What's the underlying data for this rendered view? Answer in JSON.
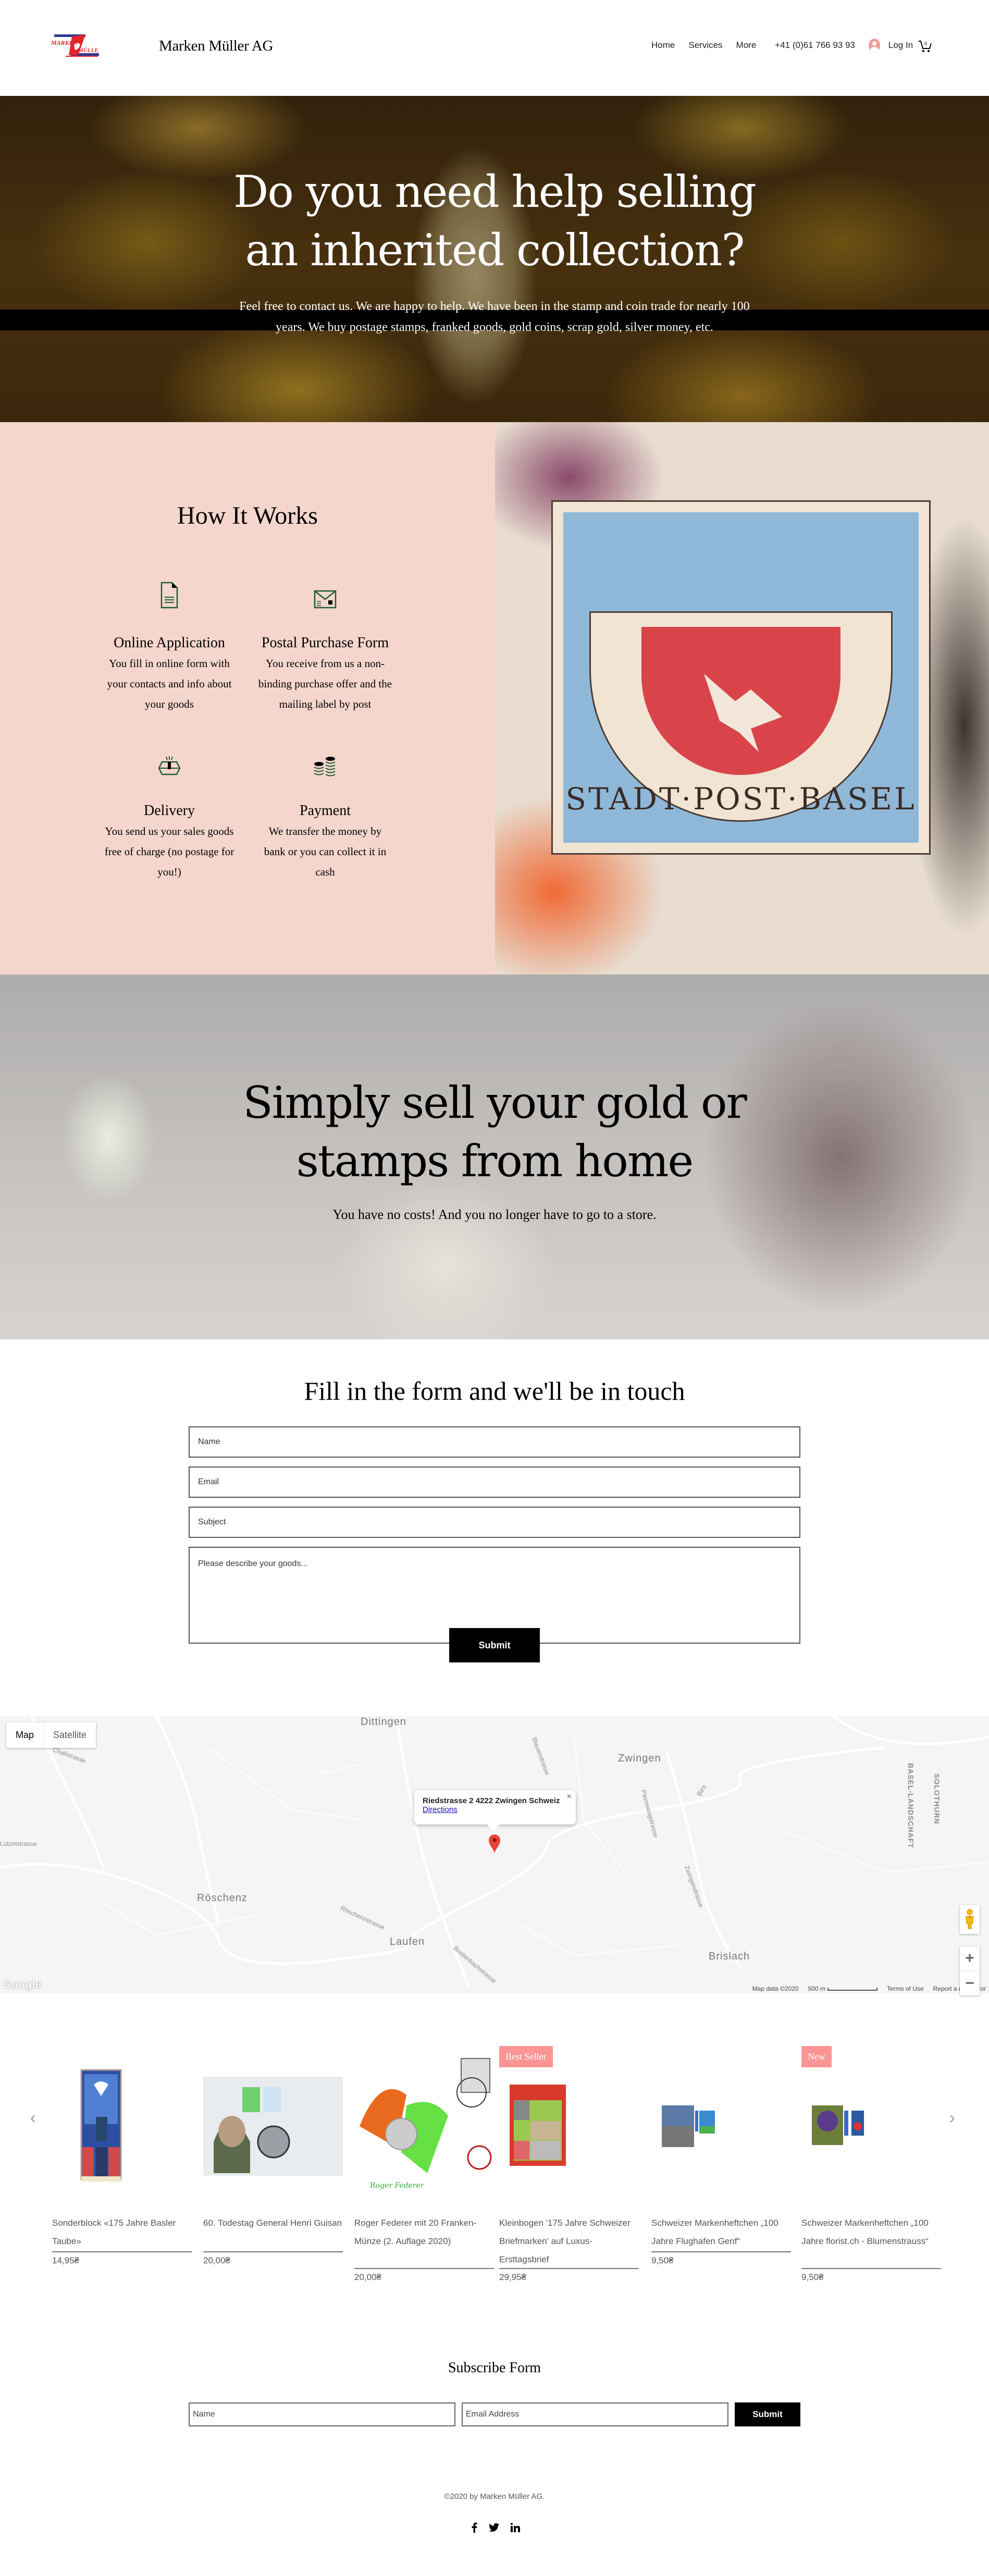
{
  "header": {
    "brand_name": "Marken Müller AG",
    "logo_text_top": "MARKEN",
    "logo_text_bottom": "MÜLLER",
    "nav": [
      "Home",
      "Services",
      "More"
    ],
    "phone": "+41 (0)61 766 93 93",
    "login_label": "Log In",
    "cart_count": "0"
  },
  "hero": {
    "title_line1": "Do you need help selling",
    "title_line2": "an inherited collection?",
    "text": "Feel free to contact us. We are happy to help. We have been in the stamp and coin trade for nearly 100 years. We buy postage stamps, franked goods, gold coins, scrap gold, silver money, etc."
  },
  "how_it_works": {
    "title": "How It Works",
    "steps": [
      {
        "icon": "document-icon",
        "title": "Online Application",
        "text": "You fill in online form with your contacts and info about your goods"
      },
      {
        "icon": "envelope-icon",
        "title": "Postal Purchase Form",
        "text": "You receive from us a non-binding purchase offer and the mailing label by post"
      },
      {
        "icon": "package-icon",
        "title": "Delivery",
        "text": "You send us your sales goods free of charge (no postage for you!)"
      },
      {
        "icon": "coins-icon",
        "title": "Payment",
        "text": "We transfer the money by bank or you can collect it in cash"
      }
    ],
    "stamp_text": "STADT·POST·BASEL"
  },
  "home_section": {
    "title_line1": "Simply sell your gold or",
    "title_line2": "stamps from home",
    "text": "You have no costs! And you no longer have to go to a store."
  },
  "contact": {
    "title": "Fill in the form and we'll be in touch",
    "name_placeholder": "Name",
    "email_placeholder": "Email",
    "subject_placeholder": "Subject",
    "message_placeholder": "Please describe your goods...",
    "submit_label": "Submit"
  },
  "map": {
    "type_map": "Map",
    "type_satellite": "Satellite",
    "address": "Riedstrasse 2 4222 Zwingen Schweiz",
    "directions": "Directions",
    "close": "×",
    "labels": {
      "dittingen": "Dittingen",
      "zwingen": "Zwingen",
      "roeschenz": "Röschenz",
      "laufen": "Laufen",
      "brislach": "Brislach",
      "basel_landschaft": "BASEL-LANDSCHAFT",
      "solothurn": "SOLOTHURN",
      "challstrasse": "Challstrasse",
      "luetzelstrasse": "Lützelstrasse",
      "blauenstrasse": "Blauenstrasse",
      "passwangstrasse": "Passwangstrasse",
      "zwingenstrasse": "Zwingenstrasse",
      "roeschenzstrasse": "Röschenzstrasse",
      "birs": "Birs",
      "breitenbachstrasse": "Breitenbachstrasse"
    },
    "footer": {
      "data": "Map data ©2020",
      "scale": "500 m",
      "terms": "Terms of Use",
      "report": "Report a map error"
    },
    "google": "Google",
    "zoom_in": "+",
    "zoom_out": "−"
  },
  "products": [
    {
      "name": "Sonderblock «175 Jahre Basler Taube»",
      "price": "14,95₴",
      "ribbon": null
    },
    {
      "name": "60. Todestag General Henri Guisan",
      "price": "20,00₴",
      "ribbon": null
    },
    {
      "name": "Roger Federer mit 20 Franken-Münze (2. Auflage 2020)",
      "price": "20,00₴",
      "ribbon": null
    },
    {
      "name": "Kleinbogen '175 Jahre Schweizer Briefmarken' auf Luxus-Ersttagsbrief",
      "price": "29,95₴",
      "ribbon": "Best Seller"
    },
    {
      "name": "Schweizer Markenheftchen „100 Jahre Flughafen Genf“",
      "price": "9,50₴",
      "ribbon": null
    },
    {
      "name": "Schweizer Markenheftchen „100 Jahre florist.ch - Blumenstrauss“",
      "price": "9,50₴",
      "ribbon": "New"
    }
  ],
  "carousel": {
    "prev": "‹",
    "next": "›"
  },
  "subscribe": {
    "title": "Subscribe Form",
    "name_placeholder": "Name",
    "email_placeholder": "Email Address",
    "submit_label": "Submit"
  },
  "footer": {
    "copyright": "©2020 by Marken Müller AG.",
    "social": [
      "f",
      "t",
      "in"
    ]
  },
  "colors": {
    "pink_section": "#f5d6cd",
    "ribbon": "#fa9594",
    "icon_green": "#1f5b32",
    "logo_red": "#e0262c",
    "logo_blue": "#2b3990"
  }
}
